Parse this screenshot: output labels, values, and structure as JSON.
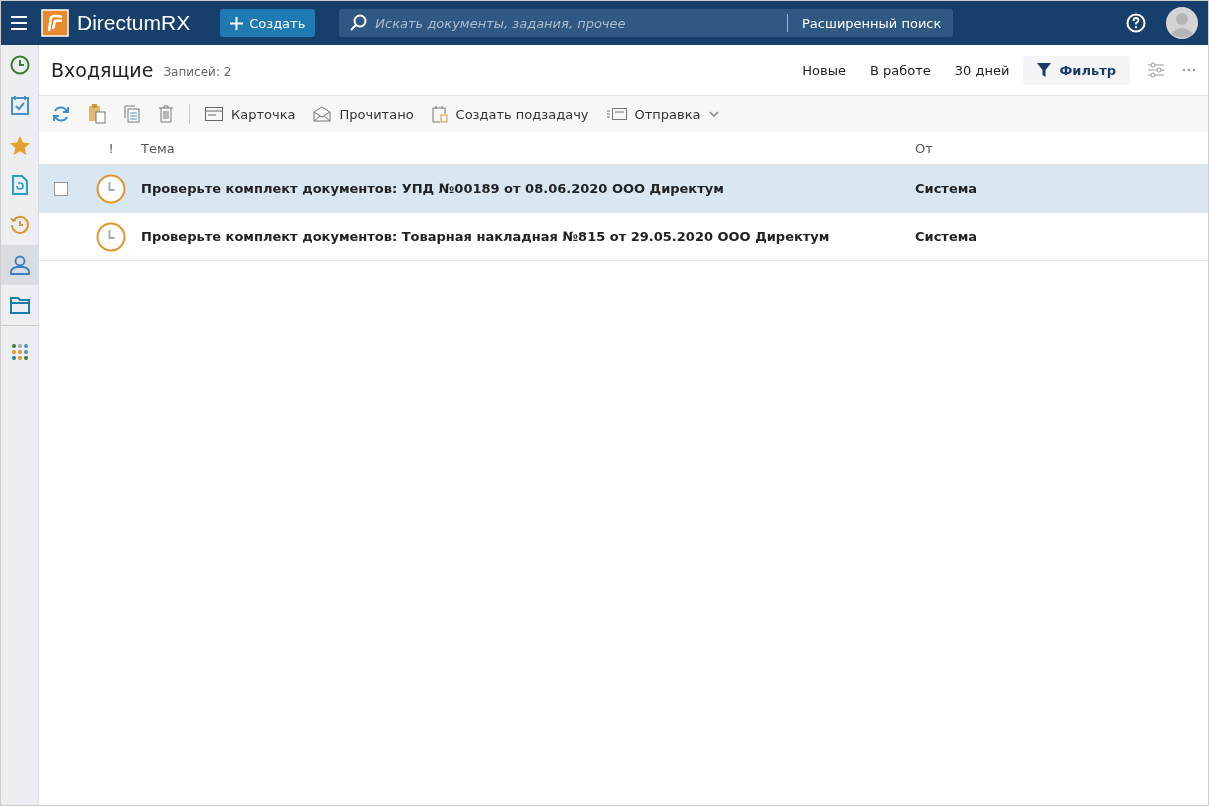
{
  "header": {
    "logo": "DirectumRX",
    "create_button": "Создать",
    "search": {
      "placeholder": "Искать документы, задания, прочее"
    },
    "advanced_search": "Расширенный поиск"
  },
  "sidebar": {
    "items": [
      {
        "kind": "clock",
        "selected": false
      },
      {
        "kind": "tasks",
        "selected": false
      },
      {
        "kind": "star",
        "selected": false
      },
      {
        "kind": "document",
        "selected": false
      },
      {
        "kind": "history",
        "selected": false
      },
      {
        "kind": "person",
        "selected": true
      },
      {
        "kind": "folder",
        "selected": false
      },
      {
        "kind": "apps",
        "selected": false
      }
    ]
  },
  "title": "Входящие",
  "record_count": "Записей: 2",
  "quick_filters": [
    {
      "label": "Новые",
      "selected": false
    },
    {
      "label": "В работе",
      "selected": false
    },
    {
      "label": "30 дней",
      "selected": false
    }
  ],
  "filter_button": {
    "label": "Фильтр",
    "selected": true
  },
  "toolbar": [
    {
      "kind": "refresh"
    },
    {
      "kind": "paste"
    },
    {
      "kind": "copy"
    },
    {
      "kind": "delete"
    },
    {
      "kind": "card",
      "label": "Карточка"
    },
    {
      "kind": "read",
      "label": "Прочитано"
    },
    {
      "kind": "subtask",
      "label": "Создать подзадачу"
    },
    {
      "kind": "send",
      "label": "Отправка"
    }
  ],
  "table": {
    "columns": [
      "!",
      "Тема",
      "От"
    ],
    "rows": [
      {
        "subject": "Проверьте комплект документов: УПД №00189 от 08.06.2020 ООО Директум",
        "from": "Система",
        "selected": true
      },
      {
        "subject": "Проверьте комплект документов: Товарная накладная №815 от 29.05.2020 ООО Директум",
        "from": "Система",
        "selected": false
      }
    ]
  }
}
